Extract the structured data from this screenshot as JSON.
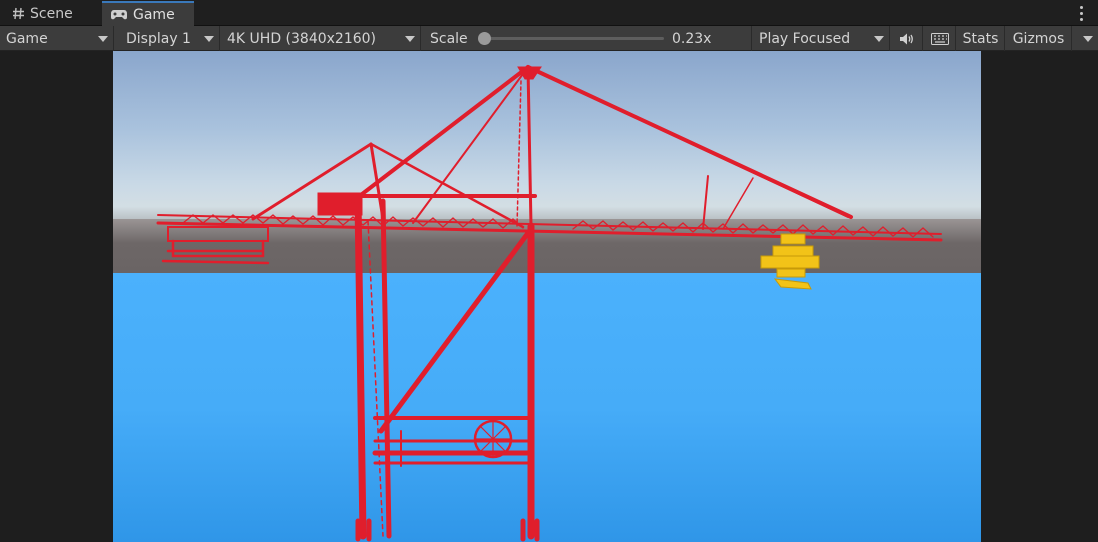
{
  "tabs": {
    "scene_label": "Scene",
    "game_label": "Game",
    "scene_icon": "hash-icon",
    "game_icon": "gamepad-icon"
  },
  "toolbar": {
    "view_type": "Game",
    "display": "Display 1",
    "resolution": "4K UHD (3840x2160)",
    "scale_label": "Scale",
    "scale_value": "0.23x",
    "scale_fraction": 0.0,
    "play_mode": "Play Focused",
    "stats_label": "Stats",
    "gizmos_label": "Gizmos"
  },
  "colors": {
    "crane": "#e01e2c",
    "vehicle": "#f2c318",
    "water": "#46acf8",
    "sky": "#8aa6cc",
    "accent_tab": "#3a79bb"
  }
}
